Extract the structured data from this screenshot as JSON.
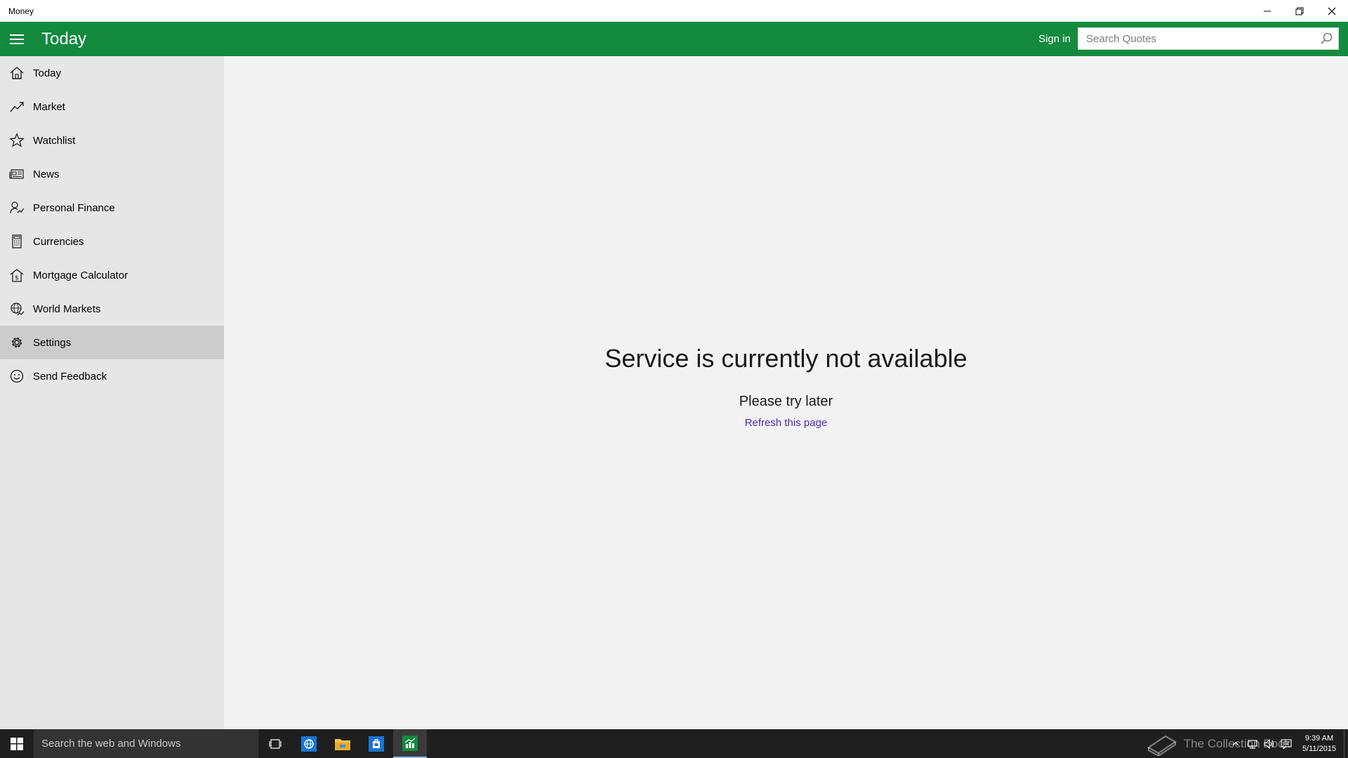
{
  "window": {
    "app_title": "Money"
  },
  "header": {
    "title": "Today",
    "signin_label": "Sign in",
    "search_placeholder": "Search Quotes",
    "accent_color": "#138a3e"
  },
  "sidebar": {
    "items": [
      {
        "label": "Today",
        "icon": "home-icon"
      },
      {
        "label": "Market",
        "icon": "trend-icon"
      },
      {
        "label": "Watchlist",
        "icon": "star-icon"
      },
      {
        "label": "News",
        "icon": "newspaper-icon"
      },
      {
        "label": "Personal Finance",
        "icon": "person-chart-icon"
      },
      {
        "label": "Currencies",
        "icon": "calculator-icon"
      },
      {
        "label": "Mortgage Calculator",
        "icon": "house-dollar-icon"
      },
      {
        "label": "World Markets",
        "icon": "globe-icon"
      },
      {
        "label": "Settings",
        "icon": "gear-icon",
        "selected": true
      },
      {
        "label": "Send Feedback",
        "icon": "smiley-icon"
      }
    ]
  },
  "main": {
    "error_title": "Service is currently not available",
    "error_subtitle": "Please try later",
    "refresh_link": "Refresh this page"
  },
  "taskbar": {
    "search_placeholder": "Search the web and Windows",
    "watermark": "The Collection Book",
    "time": "9:39 AM",
    "date": "5/11/2015"
  }
}
